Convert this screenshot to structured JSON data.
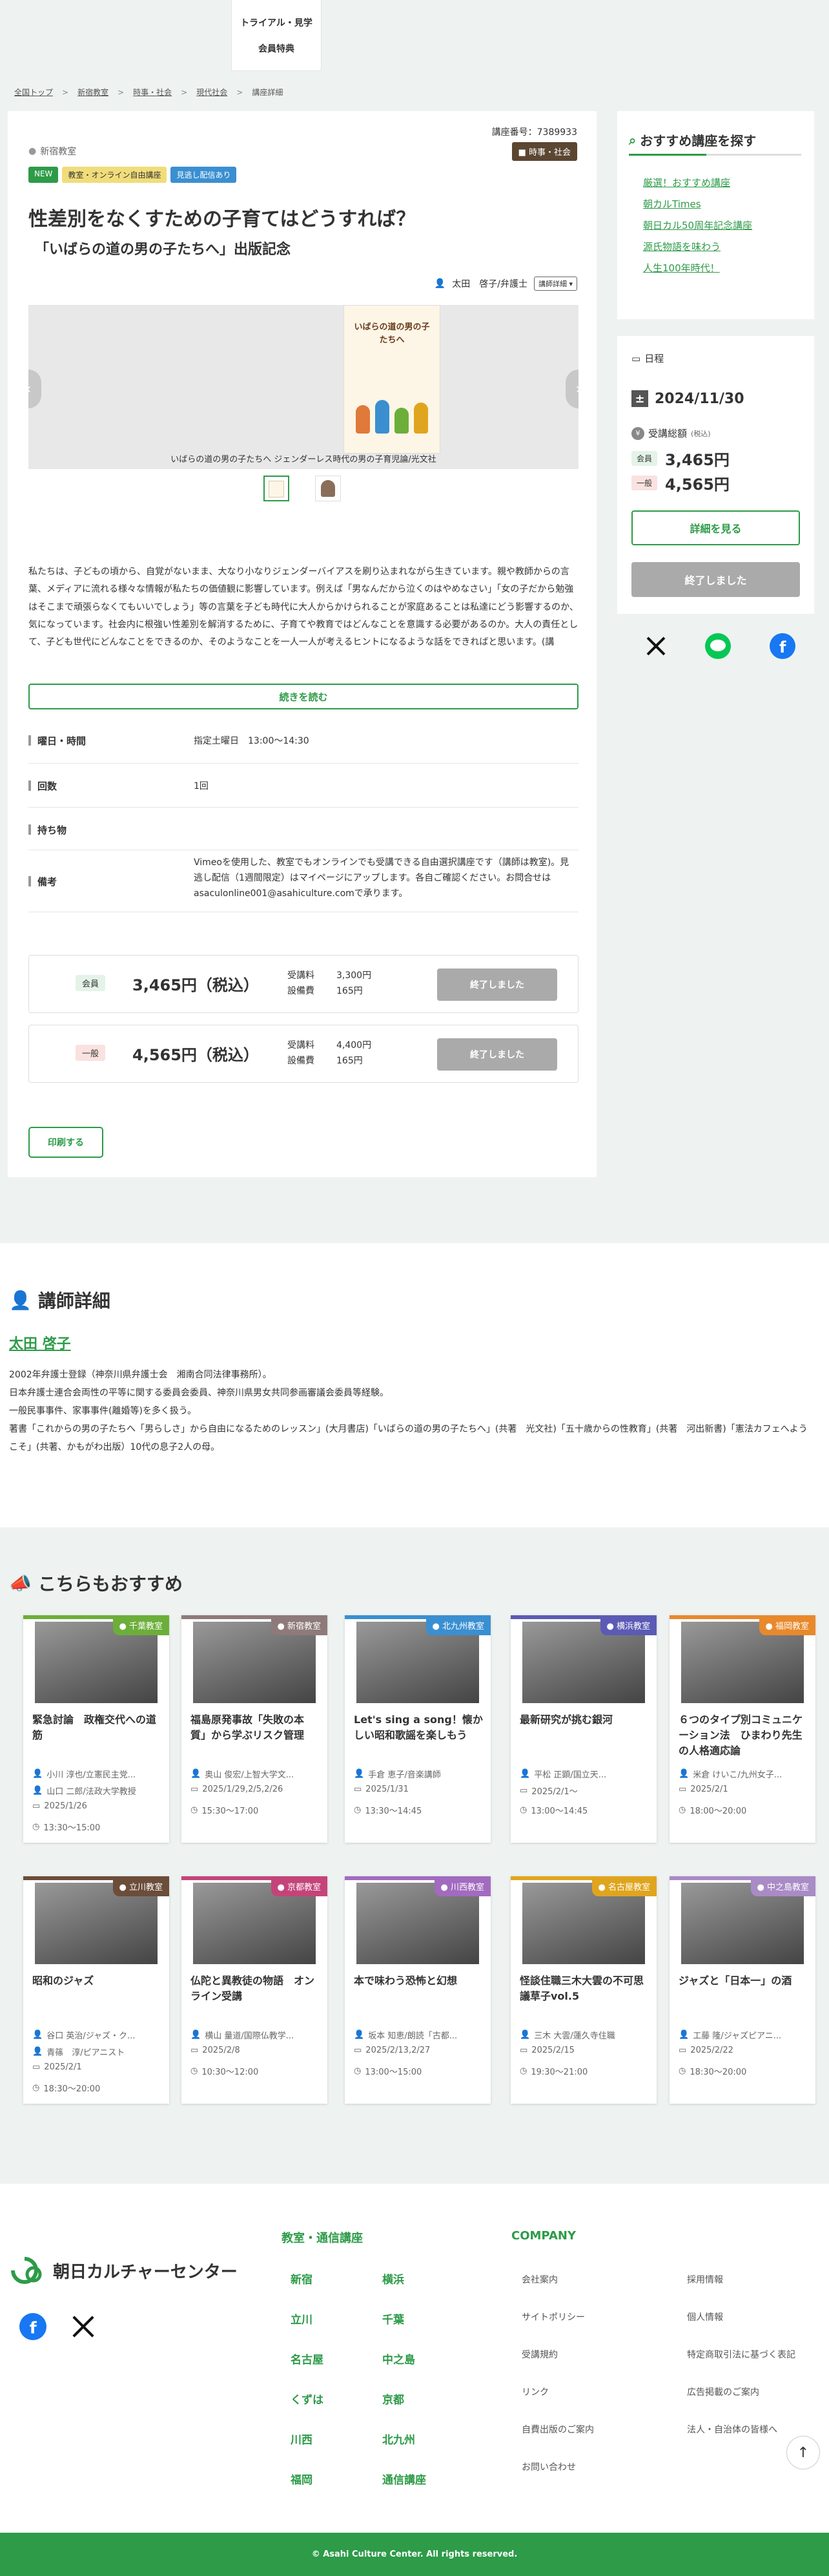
{
  "header": {
    "trial_line1": "トライアル・見学",
    "trial_line2": "会員特典"
  },
  "breadcrumb": [
    "全国トップ",
    "新宿教室",
    "時事・社会",
    "現代社会",
    "講座詳細"
  ],
  "lecture": {
    "number": "講座番号：7389933",
    "genre": "時事・社会",
    "school": "新宿教室",
    "tags": [
      "NEW",
      "教室・オンライン自由講座",
      "見逃し配信あり"
    ],
    "title": "性差別をなくすための子育てはどうすれば？",
    "subtitle": "「いばらの道の男の子たちへ」出版記念",
    "lecturer": "太田　啓子/弁護士",
    "lecturer_detail_btn": "講師詳細",
    "book_title": "いばらの道の男の子たちへ",
    "book_sub": "ジェンダーレス時代の男の子育児論",
    "slide_caption": "いばらの道の男の子たちへ ジェンダーレス時代の男の子育児論/光文社",
    "description": "私たちは、子どもの頃から、自覚がないまま、大なり小なりジェンダーバイアスを刷り込まれながら生きています。親や教師からの言葉、メディアに流れる様々な情報が私たちの価値観に影響しています。例えば「男なんだから泣くのはやめなさい」「女の子だから勉強はそこまで頑張らなくてもいいでしょう」等の言葉を子ども時代に大人からかけられることが家庭あることは私達にどう影響するのか、気になっています。社会内に根強い性差別を解消するために、子育てや教育ではどんなことを意識する必要があるのか。大人の責任として、子ども世代にどんなことをできるのか、そのようなことを一人一人が考えるヒントになるような話をできればと思います。(講",
    "read_more": "続きを読む"
  },
  "info": [
    {
      "label": "曜日・時間",
      "value": "指定土曜日　13:00〜14:30"
    },
    {
      "label": "回数",
      "value": "1回"
    },
    {
      "label": "持ち物",
      "value": ""
    },
    {
      "label": "備考",
      "value": "Vimeoを使用した、教室でもオンラインでも受講できる自由選択講座です（講師は教室)。見逃し配信（1週間限定）はマイページにアップします。各自ご確認ください。お問合せはasaculonline001@asahiculture.comで承ります。"
    }
  ],
  "prices": [
    {
      "type": "会員",
      "amount": "3,465円（税込）",
      "fee_label": "受講料",
      "fee": "3,300円",
      "facility_label": "設備費",
      "facility": "165円",
      "status": "終了しました"
    },
    {
      "type": "一般",
      "amount": "4,565円（税込）",
      "fee_label": "受講料",
      "fee": "4,400円",
      "facility_label": "設備費",
      "facility": "165円",
      "status": "終了しました"
    }
  ],
  "print_btn": "印刷する",
  "side": {
    "rec_title": "おすすめ講座を探す",
    "links": [
      "厳選！おすすめ講座",
      "朝カルTimes",
      "朝日カル50周年記念講座",
      "源氏物語を味わう",
      "人生100年時代！"
    ],
    "schedule_label": "日程",
    "date": "2024/11/30",
    "total_label": "受講総額",
    "total_note": "(税込)",
    "member_label": "会員",
    "member_price": "3,465円",
    "general_label": "一般",
    "general_price": "4,565円",
    "detail_btn": "詳細を見る",
    "ended_btn": "終了しました"
  },
  "lecturer_section": {
    "title": "講師詳細",
    "name": "太田 啓子",
    "bio": [
      "2002年弁護士登録（神奈川県弁護士会　湘南合同法律事務所）。",
      "日本弁護士連合会両性の平等に関する委員会委員、神奈川県男女共同参画審議会委員等経験。",
      "一般民事事件、家事事件(離婚等)を多く扱う。",
      "著書「これからの男の子たちへ「男らしさ」から自由になるためのレッスン」(大月書店)「いばらの道の男の子たちへ」(共著　光文社)「五十歳からの性教育」(共著　河出新書)「憲法カフェへようこそ」(共著、かもがわ出版）10代の息子2人の母。"
    ]
  },
  "recommend": {
    "title": "こちらもおすすめ",
    "courses": [
      {
        "school": "千葉教室",
        "title": "緊急討論　政権交代への道筋",
        "lecturer1": "小川 淳也/立憲民主党...",
        "lecturer2": "山口 二郎/法政大学教授",
        "date": "2025/1/26",
        "time": "13:30〜15:00",
        "color": "#6cae3a"
      },
      {
        "school": "新宿教室",
        "title": "福島原発事故「失敗の本質」から学ぶリスク管理",
        "lecturer1": "奥山 俊宏/上智大学文...",
        "lecturer2": "",
        "date": "2025/1/29,2/5,2/26",
        "time": "15:30〜17:00",
        "color": "#8e7a7a"
      },
      {
        "school": "北九州教室",
        "title": "Let's sing a song！懐かしい昭和歌謡を楽しもう",
        "lecturer1": "手倉 恵子/音楽講師",
        "lecturer2": "",
        "date": "2025/1/31",
        "time": "13:30〜14:45",
        "color": "#3a8fd1"
      },
      {
        "school": "横浜教室",
        "title": "最新研究が挑む銀河",
        "lecturer1": "平松 正顕/国立天...",
        "lecturer2": "",
        "date": "2025/2/1〜",
        "time": "13:00〜14:45",
        "color": "#5b5bb5"
      },
      {
        "school": "福岡教室",
        "title": "６つのタイプ別コミュニケーション法　ひまわり先生の人格適応論",
        "lecturer1": "米倉 けいこ/九州女子...",
        "lecturer2": "",
        "date": "2025/2/1",
        "time": "18:00〜20:00",
        "color": "#e8892c"
      },
      {
        "school": "立川教室",
        "title": "昭和のジャズ",
        "lecturer1": "谷口 英治/ジャズ・ク...",
        "lecturer2": "青篠　淳/ピアニスト",
        "date": "2025/2/1",
        "time": "18:30〜20:00",
        "color": "#6b4d3a"
      },
      {
        "school": "京都教室",
        "title": "仏陀と異教徒の物語　オンライン受講",
        "lecturer1": "横山 量道/国際仏教学...",
        "lecturer2": "",
        "date": "2025/2/8",
        "time": "10:30〜12:00",
        "color": "#c4447a"
      },
      {
        "school": "川西教室",
        "title": "本で味わう恐怖と幻想",
        "lecturer1": "坂本 知恵/朗読「古都...",
        "lecturer2": "",
        "date": "2025/2/13,2/27",
        "time": "13:00〜15:00",
        "color": "#a26bc0"
      },
      {
        "school": "名古屋教室",
        "title": "怪談住職三木大雲の不可思議草子vol.5",
        "lecturer1": "三木 大雲/蓮久寺住職",
        "lecturer2": "",
        "date": "2025/2/15",
        "time": "19:30〜21:00",
        "color": "#e0a51e"
      },
      {
        "school": "中之島教室",
        "title": "ジャズと「日本一」の酒",
        "lecturer1": "工藤 隆/ジャズピアニ...",
        "lecturer2": "",
        "date": "2025/2/22",
        "time": "18:30〜20:00",
        "color": "#a98bc6"
      }
    ]
  },
  "footer": {
    "logo": "朝日カルチャーセンター",
    "class_head": "教室・通信講座",
    "classes": [
      "新宿",
      "横浜",
      "立川",
      "千葉",
      "名古屋",
      "中之島",
      "くずは",
      "京都",
      "川西",
      "北九州",
      "福岡",
      "通信講座"
    ],
    "company_head": "COMPANY",
    "company": [
      "会社案内",
      "採用情報",
      "サイトポリシー",
      "個人情報",
      "受講規約",
      "特定商取引法に基づく表記",
      "リンク",
      "広告掲載のご案内",
      "自費出版のご案内",
      "法人・自治体の皆様へ",
      "お問い合わせ",
      ""
    ],
    "copyright": "© Asahi Culture Center. All rights reserved."
  }
}
